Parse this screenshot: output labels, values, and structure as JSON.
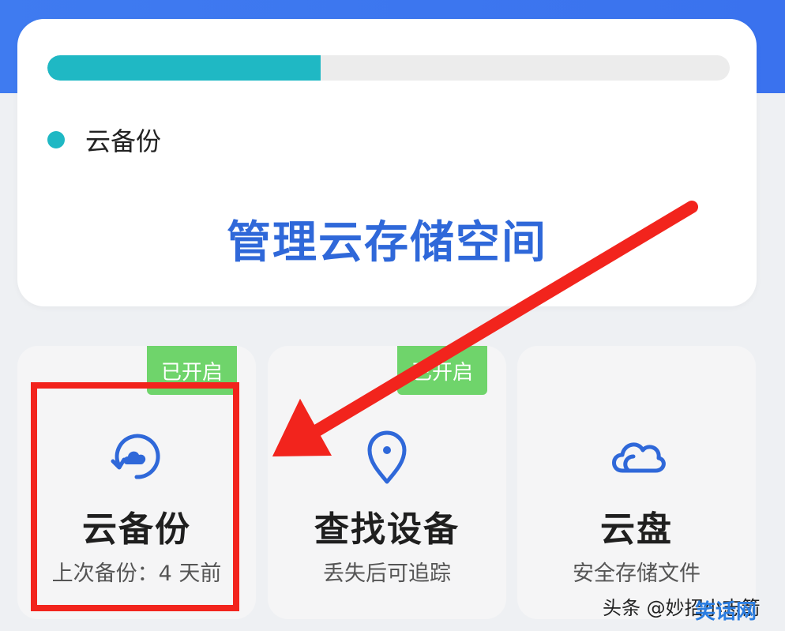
{
  "storage": {
    "progress_fraction": 0.4,
    "legend_label": "云备份",
    "manage_label": "管理云存储空间"
  },
  "tiles": [
    {
      "title": "云备份",
      "subtitle": "上次备份：4 天前",
      "badge": "已开启",
      "icon": "cloud-sync-icon"
    },
    {
      "title": "查找设备",
      "subtitle": "丢失后可追踪",
      "badge": "已开启",
      "icon": "location-pin-icon"
    },
    {
      "title": "云盘",
      "subtitle": "安全存储文件",
      "badge": "",
      "icon": "cloud-icon"
    }
  ],
  "watermark": {
    "text": "头条 @妙招小志箭",
    "logo": "笑话网"
  },
  "colors": {
    "accent": "#2f68d9",
    "progress": "#1fb8c4",
    "badge": "#6fd46b",
    "annotation": "#f2241d",
    "header": "#3f7bf0"
  }
}
